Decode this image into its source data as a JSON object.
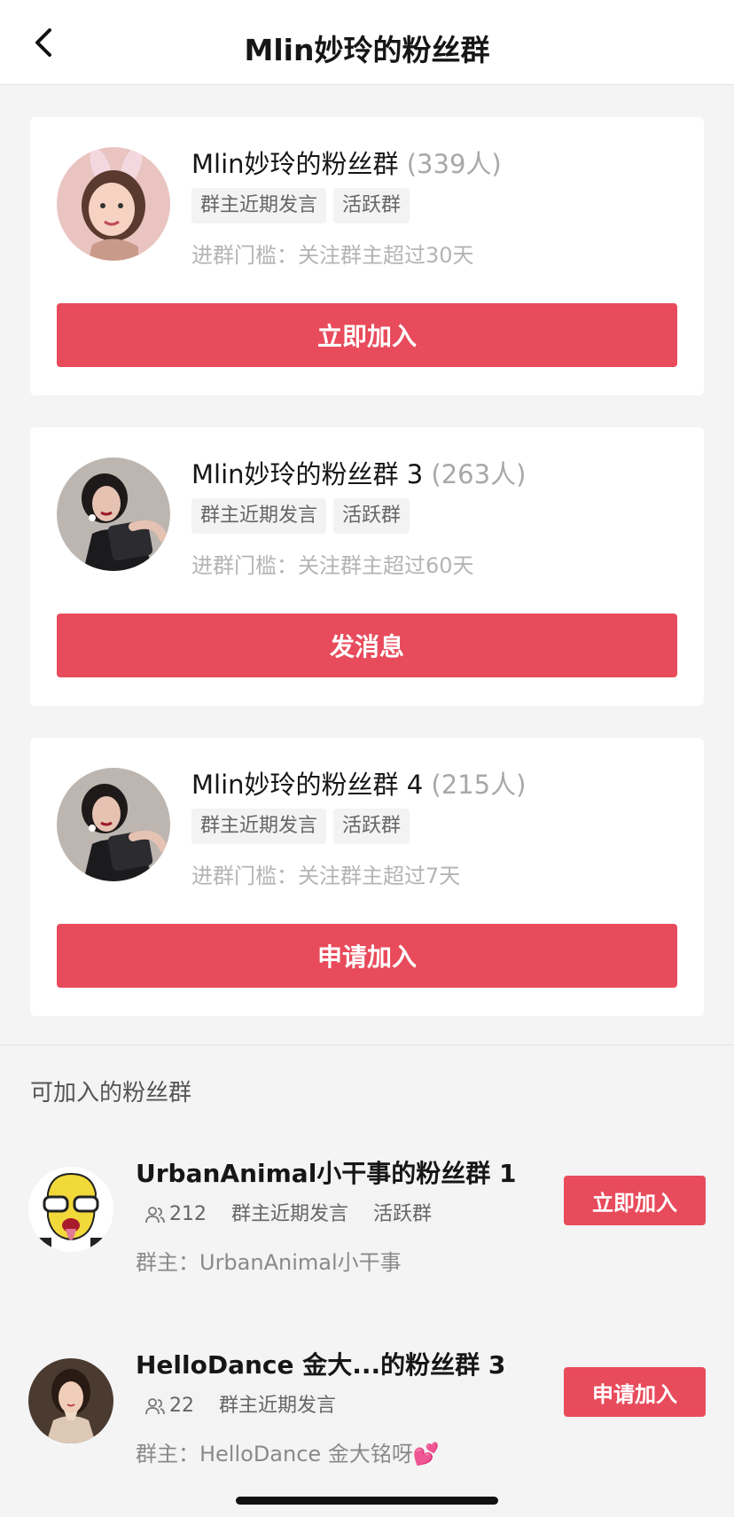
{
  "header": {
    "title": "Mlin妙玲的粉丝群",
    "back_icon": "chevron-left-icon"
  },
  "my_groups": [
    {
      "name": "Mlin妙玲的粉丝群",
      "count": "(339人)",
      "tags": [
        "群主近期发言",
        "活跃群"
      ],
      "threshold": "进群门槛：关注群主超过30天",
      "action": "立即加入"
    },
    {
      "name": "Mlin妙玲的粉丝群 3",
      "count": "(263人)",
      "tags": [
        "群主近期发言",
        "活跃群"
      ],
      "threshold": "进群门槛：关注群主超过60天",
      "action": "发消息"
    },
    {
      "name": "Mlin妙玲的粉丝群 4",
      "count": "(215人)",
      "tags": [
        "群主近期发言",
        "活跃群"
      ],
      "threshold": "进群门槛：关注群主超过7天",
      "action": "申请加入"
    }
  ],
  "joinable_section": {
    "title": "可加入的粉丝群",
    "groups": [
      {
        "name": "UrbanAnimal小干事的粉丝群 1",
        "members": "212",
        "tags": [
          "群主近期发言",
          "活跃群"
        ],
        "owner": "群主：UrbanAnimal小干事",
        "action": "立即加入"
      },
      {
        "name": "HelloDance 金大...的粉丝群 3",
        "members": "22",
        "tags": [
          "群主近期发言"
        ],
        "owner": "群主：HelloDance 金大铭呀",
        "owner_emoji": "💕",
        "action": "申请加入"
      }
    ]
  },
  "colors": {
    "accent": "#e84b5b",
    "background": "#f4f4f4",
    "card": "#ffffff"
  }
}
